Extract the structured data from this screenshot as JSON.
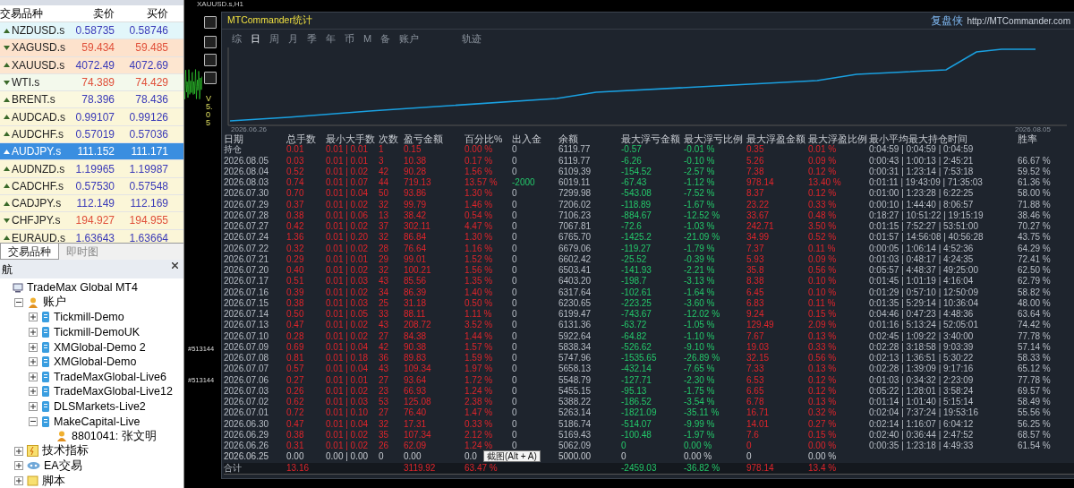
{
  "market_watch": {
    "columns": [
      "交易品种",
      "卖价",
      "买价"
    ],
    "rows": [
      {
        "symbol": "NZDUSD.s",
        "bid": "0.58735",
        "ask": "0.58746",
        "rising": true,
        "color": "#e2f6fa",
        "selected": false
      },
      {
        "symbol": "XAGUSD.s",
        "bid": "59.434",
        "ask": "59.485",
        "rising": false,
        "color": "#fde2cc",
        "selected": false
      },
      {
        "symbol": "XAUUSD.s",
        "bid": "4072.49",
        "ask": "4072.69",
        "rising": true,
        "color": "#fde6d0",
        "selected": false
      },
      {
        "symbol": "WTI.s",
        "bid": "74.389",
        "ask": "74.429",
        "rising": false,
        "color": "#f3f9ec",
        "selected": false
      },
      {
        "symbol": "BRENT.s",
        "bid": "78.396",
        "ask": "78.436",
        "rising": true,
        "color": "#fbf8df",
        "selected": false
      },
      {
        "symbol": "AUDCAD.s",
        "bid": "0.99107",
        "ask": "0.99126",
        "rising": true,
        "color": "#fbf6d8",
        "selected": false
      },
      {
        "symbol": "AUDCHF.s",
        "bid": "0.57019",
        "ask": "0.57036",
        "rising": true,
        "color": "#fbf6d8",
        "selected": false
      },
      {
        "symbol": "AUDJPY.s",
        "bid": "111.152",
        "ask": "111.171",
        "rising": true,
        "color": "#3a8ee0",
        "selected": true
      },
      {
        "symbol": "AUDNZD.s",
        "bid": "1.19965",
        "ask": "1.19987",
        "rising": true,
        "color": "#fbf6d8",
        "selected": false
      },
      {
        "symbol": "CADCHF.s",
        "bid": "0.57530",
        "ask": "0.57548",
        "rising": true,
        "color": "#fbf6d8",
        "selected": false
      },
      {
        "symbol": "CADJPY.s",
        "bid": "112.149",
        "ask": "112.169",
        "rising": true,
        "color": "#fbf6d8",
        "selected": false
      },
      {
        "symbol": "CHFJPY.s",
        "bid": "194.927",
        "ask": "194.955",
        "rising": false,
        "color": "#fbf6d8",
        "selected": false
      },
      {
        "symbol": "EURAUD.s",
        "bid": "1.63643",
        "ask": "1.63664",
        "rising": true,
        "color": "#fbf6d8",
        "selected": false
      }
    ],
    "tabs": [
      {
        "label": "交易品种",
        "selected": true
      },
      {
        "label": "即时图",
        "selected": false
      }
    ]
  },
  "navigator": {
    "title": "航",
    "tree": [
      {
        "label": "TradeMax Global MT4",
        "kind": "terminal",
        "children": [
          {
            "label": "账户",
            "kind": "accounts",
            "expanded": true,
            "children": [
              {
                "label": "Tickmill-Demo",
                "kind": "server",
                "expanded": false
              },
              {
                "label": "Tickmill-DemoUK",
                "kind": "server",
                "expanded": false
              },
              {
                "label": "XMGlobal-Demo 2",
                "kind": "server",
                "expanded": false
              },
              {
                "label": "XMGlobal-Demo",
                "kind": "server",
                "expanded": false
              },
              {
                "label": "TradeMaxGlobal-Live6",
                "kind": "server",
                "expanded": false
              },
              {
                "label": "TradeMaxGlobal-Live12",
                "kind": "server",
                "expanded": false
              },
              {
                "label": "DLSMarkets-Live2",
                "kind": "server",
                "expanded": false
              },
              {
                "label": "MakeCapital-Live",
                "kind": "server",
                "expanded": true,
                "children": [
                  {
                    "label": "8801041: 张文明",
                    "kind": "user"
                  }
                ]
              }
            ]
          },
          {
            "label": "技术指标",
            "kind": "indicator",
            "expanded": false
          },
          {
            "label": "EA交易",
            "kind": "ea",
            "expanded": false
          },
          {
            "label": "脚本",
            "kind": "script",
            "expanded": false
          }
        ]
      }
    ]
  },
  "chart_window": {
    "title": "XAUUSD.s,H1",
    "version": "V 5.05",
    "order_labels": [
      "#513144",
      "#513144"
    ]
  },
  "stats_panel": {
    "title": "MTCommander统计",
    "brand": "复盘侠",
    "link": "http://MTCommander.com",
    "tabs": [
      {
        "label": "综",
        "selected": false
      },
      {
        "label": "日",
        "selected": true
      },
      {
        "label": "周",
        "selected": false
      },
      {
        "label": "月",
        "selected": false
      },
      {
        "label": "季",
        "selected": false
      },
      {
        "label": "年",
        "selected": false
      },
      {
        "label": "币",
        "selected": false
      },
      {
        "label": "M",
        "selected": false
      },
      {
        "label": "备",
        "selected": false
      },
      {
        "label": "账户",
        "selected": false
      },
      {
        "label": "轨迹",
        "selected": false
      }
    ],
    "curve": {
      "start_label": "2026.06.26",
      "end_label": "2026.08.05"
    },
    "tooltip": "截图(Alt + A)",
    "table": {
      "columns": [
        {
          "label": "日期",
          "kind": "text"
        },
        {
          "label": "总手数",
          "kind": "gain"
        },
        {
          "label": "最小大手数",
          "kind": "gain"
        },
        {
          "label": "次数",
          "kind": "gain"
        },
        {
          "label": "盈亏金额",
          "kind": "gain"
        },
        {
          "label": "百分比%",
          "kind": "gain"
        },
        {
          "label": "出入金",
          "kind": "flow"
        },
        {
          "label": "余额",
          "kind": "text"
        },
        {
          "label": "最大浮亏金额",
          "kind": "loss"
        },
        {
          "label": "最大浮亏比例",
          "kind": "loss"
        },
        {
          "label": "最大浮盈金额",
          "kind": "gain"
        },
        {
          "label": "最大浮盈比例",
          "kind": "gain"
        },
        {
          "label": "最小平均最大持仓时间",
          "kind": "text"
        },
        {
          "label": "胜率",
          "kind": "text"
        }
      ],
      "rows": [
        {
          "kind": "day",
          "deposit_moved": false,
          "cells": [
            "持仓",
            "0.01",
            "0.01 | 0.01",
            "1",
            "0.15",
            "0.00 %",
            "0",
            "6119.77",
            "-0.57",
            "-0.01 %",
            "0.35",
            "0.01 %",
            "0:04:59 | 0:04:59 | 0:04:59",
            null
          ]
        },
        {
          "kind": "day",
          "deposit_moved": false,
          "cells": [
            "2026.08.05",
            "0.03",
            "0.01 | 0.01",
            "3",
            "10.38",
            "0.17 %",
            "0",
            "6119.77",
            "-6.26",
            "-0.10 %",
            "5.26",
            "0.09 %",
            "0:00:43 | 1:00:13 | 2:45:21",
            "66.67 %"
          ]
        },
        {
          "kind": "day",
          "deposit_moved": false,
          "cells": [
            "2026.08.04",
            "0.52",
            "0.01 | 0.02",
            "42",
            "90.28",
            "1.56 %",
            "0",
            "6109.39",
            "-154.52",
            "-2.57 %",
            "7.38",
            "0.12 %",
            "0:00:31 | 1:23:14 | 7:53:18",
            "59.52 %"
          ]
        },
        {
          "kind": "day",
          "deposit_moved": true,
          "cells": [
            "2026.08.03",
            "0.74",
            "0.01 | 0.07",
            "44",
            "719.13",
            "13.57 %",
            "-2000",
            "6019.11",
            "-67.43",
            "-1.12 %",
            "978.14",
            "13.40 %",
            "0:01:11 | 19:43:09 | 71:35:03",
            "61.36 %"
          ]
        },
        {
          "kind": "day",
          "deposit_moved": false,
          "cells": [
            "2026.07.30",
            "0.70",
            "0.01 | 0.04",
            "50",
            "93.86",
            "1.30 %",
            "0",
            "7299.98",
            "-543.08",
            "-7.52 %",
            "8.37",
            "0.12 %",
            "0:01:00 | 1:23:28 | 6:22:25",
            "58.00 %"
          ]
        },
        {
          "kind": "day",
          "deposit_moved": false,
          "cells": [
            "2026.07.29",
            "0.37",
            "0.01 | 0.02",
            "32",
            "99.79",
            "1.46 %",
            "0",
            "7206.02",
            "-118.89",
            "-1.67 %",
            "23.22",
            "0.33 %",
            "0:00:10 | 1:44:40 | 8:06:57",
            "71.88 %"
          ]
        },
        {
          "kind": "day",
          "deposit_moved": false,
          "cells": [
            "2026.07.28",
            "0.38",
            "0.01 | 0.06",
            "13",
            "38.42",
            "0.54 %",
            "0",
            "7106.23",
            "-884.67",
            "-12.52 %",
            "33.67",
            "0.48 %",
            "0:18:27 | 10:51:22 | 19:15:19",
            "38.46 %"
          ]
        },
        {
          "kind": "day",
          "deposit_moved": false,
          "cells": [
            "2026.07.27",
            "0.42",
            "0.01 | 0.02",
            "37",
            "302.11",
            "4.47 %",
            "0",
            "7067.81",
            "-72.6",
            "-1.03 %",
            "242.71",
            "3.50 %",
            "0:01:15 | 7:52:27 | 53:51:00",
            "70.27 %"
          ]
        },
        {
          "kind": "day",
          "deposit_moved": false,
          "cells": [
            "2026.07.24",
            "1.36",
            "0.01 | 0.20",
            "32",
            "86.84",
            "1.30 %",
            "0",
            "6765.70",
            "-1425.2",
            "-21.09 %",
            "34.99",
            "0.52 %",
            "0:01:57 | 14:56:08 | 40:56:28",
            "43.75 %"
          ]
        },
        {
          "kind": "day",
          "deposit_moved": false,
          "cells": [
            "2026.07.22",
            "0.32",
            "0.01 | 0.02",
            "28",
            "76.64",
            "1.16 %",
            "0",
            "6679.06",
            "-119.27",
            "-1.79 %",
            "7.37",
            "0.11 %",
            "0:00:05 | 1:06:14 | 4:52:36",
            "64.29 %"
          ]
        },
        {
          "kind": "day",
          "deposit_moved": false,
          "cells": [
            "2026.07.21",
            "0.29",
            "0.01 | 0.01",
            "29",
            "99.01",
            "1.52 %",
            "0",
            "6602.42",
            "-25.52",
            "-0.39 %",
            "5.93",
            "0.09 %",
            "0:01:03 | 0:48:17 | 4:24:35",
            "72.41 %"
          ]
        },
        {
          "kind": "day",
          "deposit_moved": false,
          "cells": [
            "2026.07.20",
            "0.40",
            "0.01 | 0.02",
            "32",
            "100.21",
            "1.56 %",
            "0",
            "6503.41",
            "-141.93",
            "-2.21 %",
            "35.8",
            "0.56 %",
            "0:05:57 | 4:48:37 | 49:25:00",
            "62.50 %"
          ]
        },
        {
          "kind": "day",
          "deposit_moved": false,
          "cells": [
            "2026.07.17",
            "0.51",
            "0.01 | 0.03",
            "43",
            "85.56",
            "1.35 %",
            "0",
            "6403.20",
            "-198.7",
            "-3.13 %",
            "8.38",
            "0.10 %",
            "0:01:45 | 1:01:19 | 4:16:04",
            "62.79 %"
          ]
        },
        {
          "kind": "day",
          "deposit_moved": false,
          "cells": [
            "2026.07.16",
            "0.39",
            "0.01 | 0.02",
            "34",
            "86.39",
            "1.40 %",
            "0",
            "6317.64",
            "-102.61",
            "-1.64 %",
            "6.45",
            "0.10 %",
            "0:01:29 | 0:57:10 | 12:50:09",
            "58.82 %"
          ]
        },
        {
          "kind": "day",
          "deposit_moved": false,
          "cells": [
            "2026.07.15",
            "0.38",
            "0.01 | 0.03",
            "25",
            "31.18",
            "0.50 %",
            "0",
            "6230.65",
            "-223.25",
            "-3.60 %",
            "6.83",
            "0.11 %",
            "0:01:35 | 5:29:14 | 10:36:04",
            "48.00 %"
          ]
        },
        {
          "kind": "day",
          "deposit_moved": false,
          "cells": [
            "2026.07.14",
            "0.50",
            "0.01 | 0.05",
            "33",
            "88.11",
            "1.11 %",
            "0",
            "6199.47",
            "-743.67",
            "-12.02 %",
            "9.24",
            "0.15 %",
            "0:04:46 | 0:47:23 | 4:48:36",
            "63.64 %"
          ]
        },
        {
          "kind": "day",
          "deposit_moved": false,
          "cells": [
            "2026.07.13",
            "0.47",
            "0.01 | 0.02",
            "43",
            "208.72",
            "3.52 %",
            "0",
            "6131.36",
            "-63.72",
            "-1.05 %",
            "129.49",
            "2.09 %",
            "0:01:16 | 5:13:24 | 52:05:01",
            "74.42 %"
          ]
        },
        {
          "kind": "day",
          "deposit_moved": false,
          "cells": [
            "2026.07.10",
            "0.28",
            "0.01 | 0.02",
            "27",
            "84.38",
            "1.44 %",
            "0",
            "5922.64",
            "-64.82",
            "-1.10 %",
            "7.67",
            "0.13 %",
            "0:02:45 | 1:09:22 | 3:40:00",
            "77.78 %"
          ]
        },
        {
          "kind": "day",
          "deposit_moved": false,
          "cells": [
            "2026.07.09",
            "0.69",
            "0.01 | 0.04",
            "42",
            "90.38",
            "1.57 %",
            "0",
            "5838.34",
            "-526.62",
            "-9.10 %",
            "19.03",
            "0.33 %",
            "0:02:28 | 3:18:58 | 9:03:39",
            "57.14 %"
          ]
        },
        {
          "kind": "day",
          "deposit_moved": false,
          "cells": [
            "2026.07.08",
            "0.81",
            "0.01 | 0.18",
            "36",
            "89.83",
            "1.59 %",
            "0",
            "5747.96",
            "-1535.65",
            "-26.89 %",
            "32.15",
            "0.56 %",
            "0:02:13 | 1:36:51 | 5:30:22",
            "58.33 %"
          ]
        },
        {
          "kind": "day",
          "deposit_moved": false,
          "cells": [
            "2026.07.07",
            "0.57",
            "0.01 | 0.04",
            "43",
            "109.34",
            "1.97 %",
            "0",
            "5658.13",
            "-432.14",
            "-7.65 %",
            "7.33",
            "0.13 %",
            "0:02:28 | 1:39:09 | 9:17:16",
            "65.12 %"
          ]
        },
        {
          "kind": "day",
          "deposit_moved": false,
          "cells": [
            "2026.07.06",
            "0.27",
            "0.01 | 0.01",
            "27",
            "93.64",
            "1.72 %",
            "0",
            "5548.79",
            "-127.71",
            "-2.30 %",
            "6.53",
            "0.12 %",
            "0:01:03 | 0:34:32 | 2:23:09",
            "77.78 %"
          ]
        },
        {
          "kind": "day",
          "deposit_moved": false,
          "cells": [
            "2026.07.03",
            "0.26",
            "0.01 | 0.02",
            "23",
            "66.93",
            "1.24 %",
            "0",
            "5455.15",
            "-95.13",
            "-1.75 %",
            "6.65",
            "0.12 %",
            "0:05:22 | 1:28:01 | 3:58:24",
            "69.57 %"
          ]
        },
        {
          "kind": "day",
          "deposit_moved": false,
          "cells": [
            "2026.07.02",
            "0.62",
            "0.01 | 0.03",
            "53",
            "125.08",
            "2.38 %",
            "0",
            "5388.22",
            "-186.52",
            "-3.54 %",
            "6.78",
            "0.13 %",
            "0:01:14 | 1:01:40 | 5:15:14",
            "58.49 %"
          ]
        },
        {
          "kind": "day",
          "deposit_moved": false,
          "cells": [
            "2026.07.01",
            "0.72",
            "0.01 | 0.10",
            "27",
            "76.40",
            "1.47 %",
            "0",
            "5263.14",
            "-1821.09",
            "-35.11 %",
            "16.71",
            "0.32 %",
            "0:02:04 | 7:37:24 | 19:53:16",
            "55.56 %"
          ]
        },
        {
          "kind": "day",
          "deposit_moved": false,
          "cells": [
            "2026.06.30",
            "0.47",
            "0.01 | 0.04",
            "32",
            "17.31",
            "0.33 %",
            "0",
            "5186.74",
            "-514.07",
            "-9.99 %",
            "14.01",
            "0.27 %",
            "0:02:14 | 1:16:07 | 6:04:12",
            "56.25 %"
          ]
        },
        {
          "kind": "day",
          "deposit_moved": false,
          "cells": [
            "2026.06.29",
            "0.38",
            "0.01 | 0.02",
            "35",
            "107.34",
            "2.12 %",
            "0",
            "5169.43",
            "-100.48",
            "-1.97 %",
            "7.6",
            "0.15 %",
            "0:02:40 | 0:36:44 | 2:47:52",
            "68.57 %"
          ]
        },
        {
          "kind": "day",
          "deposit_moved": false,
          "cells": [
            "2026.06.26",
            "0.31",
            "0.01 | 0.02",
            "26",
            "62.09",
            "1.24 %",
            "0",
            "5062.09",
            "0",
            "0.00 %",
            "0",
            "0.00 %",
            "0:00:35 | 1:23:18 | 4:49:33",
            "61.54 %"
          ]
        },
        {
          "kind": "flat",
          "cells": [
            "2026.06.25",
            "0.00",
            "0.00 | 0.00",
            "0",
            "0.00",
            "0.0",
            null,
            "5000.00",
            "0",
            "0.00 %",
            "0",
            "0.00 %",
            null,
            null
          ]
        },
        {
          "kind": "total",
          "cells": [
            "合计",
            "13.16",
            null,
            null,
            "3119.92",
            "63.47 %",
            null,
            null,
            "-2459.03",
            "-36.82 %",
            "978.14",
            "13.4 %",
            null,
            null
          ]
        }
      ]
    }
  }
}
